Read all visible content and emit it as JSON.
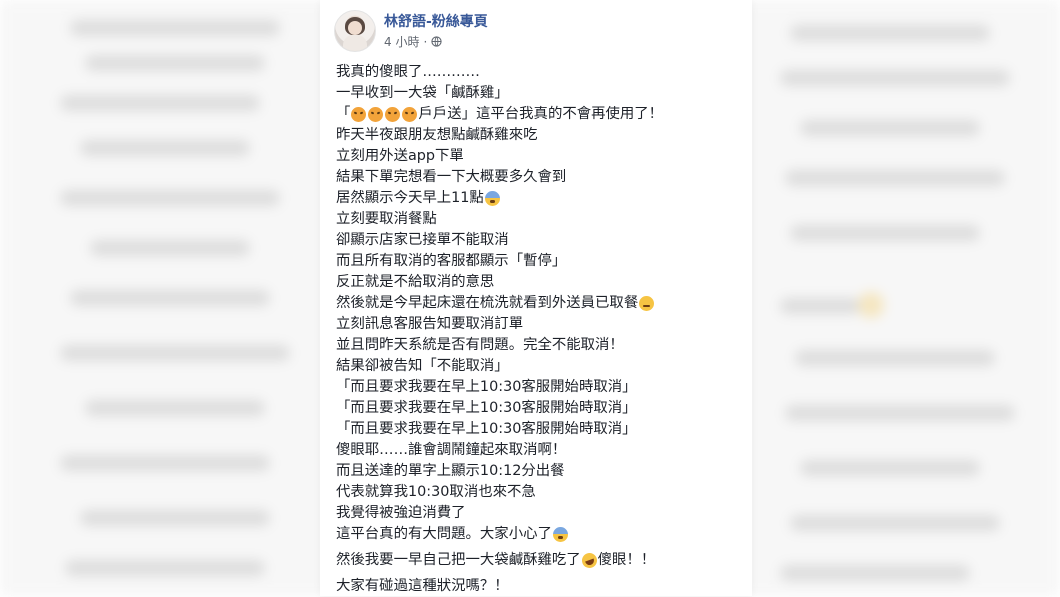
{
  "post": {
    "page_name": "林舒語-粉絲專頁",
    "time": "4 小時",
    "separator": "·",
    "lines": [
      "我真的傻眼了…………",
      "一早收到一大袋「鹹酥雞」",
      "這平台我真的不會再使用了！",
      "昨天半夜跟朋友想點鹹酥雞來吃",
      "立刻用外送app下單",
      "結果下單完想看一下大概要多久會到",
      "居然顯示今天早上11點",
      "立刻要取消餐點",
      "卻顯示店家已接單不能取消",
      "而且所有取消的客服都顯示「暫停」",
      "反正就是不給取消的意思",
      "然後就是今早起床還在梳洗就看到外送員已取餐",
      "立刻訊息客服告知要取消訂單",
      "並且問昨天系統是否有問題。完全不能取消！",
      "結果卻被告知「不能取消」",
      "「而且要求我要在早上10:30客服開始時取消」",
      "「而且要求我要在早上10:30客服開始時取消」",
      "「而且要求我要在早上10:30客服開始時取消」",
      "傻眼耶……誰會調鬧鐘起來取消啊！",
      "而且送達的單字上顯示10:12分出餐",
      "代表就算我10:30取消也來不急",
      "我覺得被強迫消費了",
      "這平台真的有大問題。大家小心了",
      "然後我要一早自己把一大袋鹹酥雞吃了",
      "傻眼！！",
      "大家有碰過這種狀況嗎？！"
    ],
    "quote_open": "「",
    "quote_mid": "戶戶送」",
    "icons": {
      "privacy": "globe-icon",
      "angry": "angry-emoji-icon",
      "fear": "fearful-emoji-icon",
      "sad": "sad-emoji-icon",
      "laugh": "rolling-laugh-emoji-icon"
    }
  }
}
